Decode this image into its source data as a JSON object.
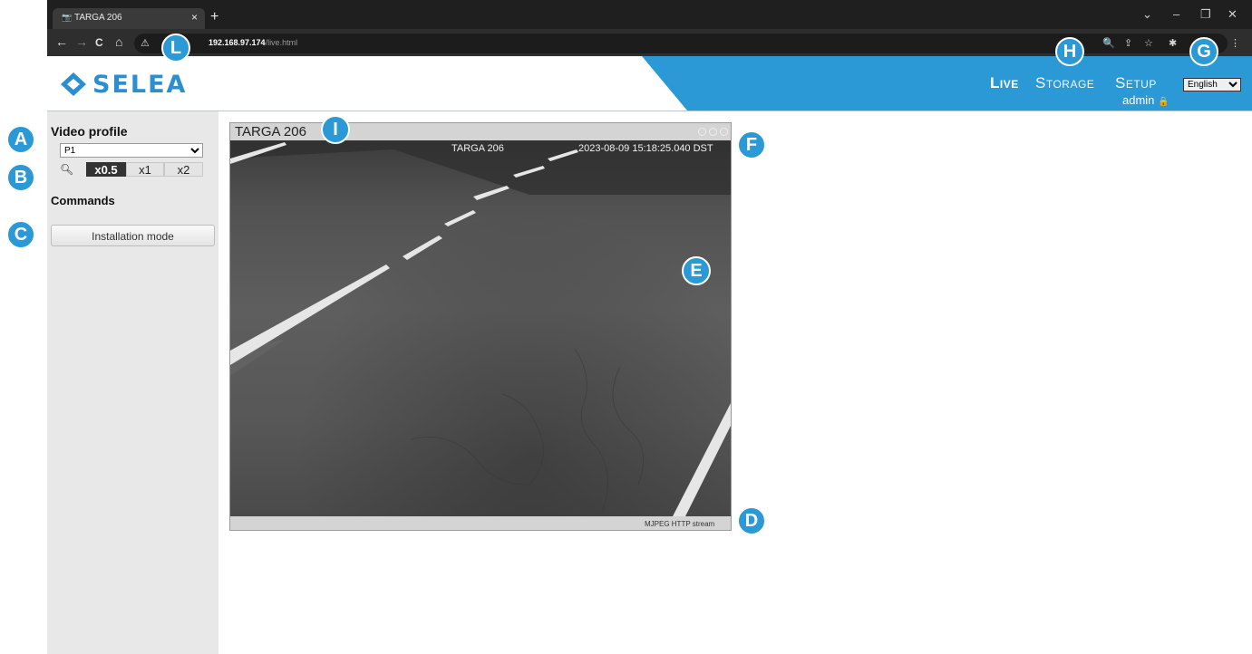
{
  "browser": {
    "tab_title": "TARGA 206",
    "tab_close": "×",
    "new_tab": "+",
    "url_host": "192.168.97.174",
    "url_path": "/live.html",
    "window_controls": [
      "⌄",
      "–",
      "❐",
      "✕"
    ],
    "nav_icons": [
      "←",
      "→",
      "C",
      "⌂",
      "⚠"
    ],
    "toolbar_icons": [
      "🔍",
      "⇪",
      "☆",
      "✱",
      "⋮"
    ]
  },
  "header": {
    "logo_text": "SELEA",
    "nav": {
      "live": "Live",
      "storage": "Storage",
      "setup": "Setup"
    },
    "language_selected": "English",
    "user": "admin",
    "accent_color": "#2a99d6"
  },
  "sidebar": {
    "video_profile_label": "Video profile",
    "profile_selected": "P1",
    "zoom_options": [
      "x0.5",
      "x1",
      "x2"
    ],
    "zoom_selected": "x0.5",
    "commands_label": "Commands",
    "install_button": "Installation mode"
  },
  "video": {
    "title": "TARGA 206",
    "caption": "TARGA 206",
    "timestamp": "2023-08-09 15:18:25.040 DST",
    "status": "MJPEG HTTP stream"
  },
  "markers": [
    "A",
    "B",
    "C",
    "D",
    "E",
    "F",
    "G",
    "H",
    "I",
    "L"
  ]
}
